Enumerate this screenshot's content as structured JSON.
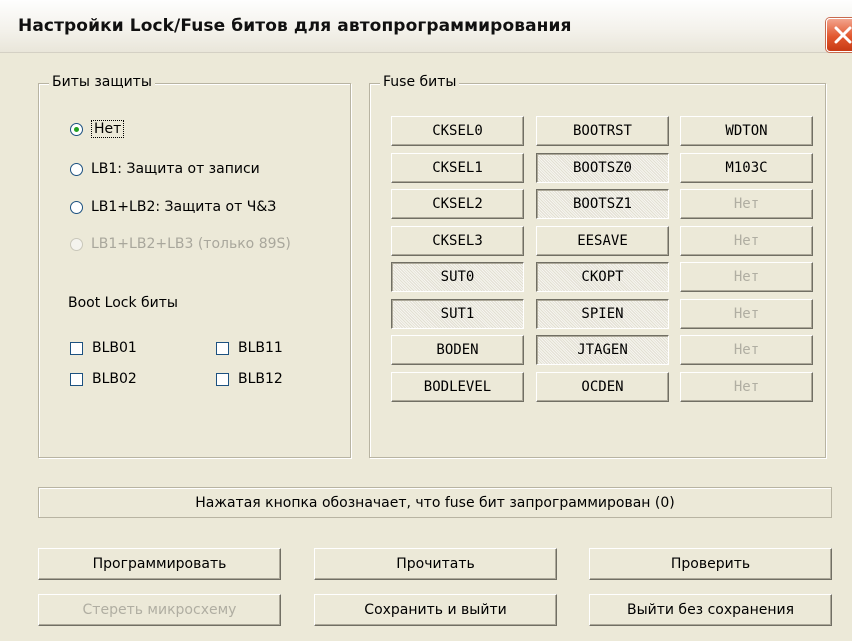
{
  "window": {
    "title": "Настройки Lock/Fuse битов для автопрограммирования",
    "close_icon": "close-icon"
  },
  "protection": {
    "legend": "Биты защиты",
    "options": [
      {
        "label": "Нет",
        "selected": true,
        "disabled": false
      },
      {
        "label": "LB1: Защита от записи",
        "selected": false,
        "disabled": false
      },
      {
        "label": "LB1+LB2: Защита от Ч&З",
        "selected": false,
        "disabled": false
      },
      {
        "label": "LB1+LB2+LB3 (только 89S)",
        "selected": false,
        "disabled": true
      }
    ],
    "boot_lock_label": "Boot Lock биты",
    "boot_lock": [
      {
        "label": "BLB01",
        "checked": false
      },
      {
        "label": "BLB11",
        "checked": false
      },
      {
        "label": "BLB02",
        "checked": false
      },
      {
        "label": "BLB12",
        "checked": false
      }
    ]
  },
  "fuse": {
    "legend": "Fuse биты",
    "col1": [
      {
        "label": "CKSEL0",
        "pressed": false,
        "disabled": false
      },
      {
        "label": "CKSEL1",
        "pressed": false,
        "disabled": false
      },
      {
        "label": "CKSEL2",
        "pressed": false,
        "disabled": false
      },
      {
        "label": "CKSEL3",
        "pressed": false,
        "disabled": false
      },
      {
        "label": "SUT0",
        "pressed": true,
        "disabled": false
      },
      {
        "label": "SUT1",
        "pressed": true,
        "disabled": false
      },
      {
        "label": "BODEN",
        "pressed": false,
        "disabled": false
      },
      {
        "label": "BODLEVEL",
        "pressed": false,
        "disabled": false
      }
    ],
    "col2": [
      {
        "label": "BOOTRST",
        "pressed": false,
        "disabled": false
      },
      {
        "label": "BOOTSZ0",
        "pressed": true,
        "disabled": false
      },
      {
        "label": "BOOTSZ1",
        "pressed": true,
        "disabled": false
      },
      {
        "label": "EESAVE",
        "pressed": false,
        "disabled": false
      },
      {
        "label": "CKOPT",
        "pressed": true,
        "disabled": false
      },
      {
        "label": "SPIEN",
        "pressed": true,
        "disabled": false
      },
      {
        "label": "JTAGEN",
        "pressed": true,
        "disabled": false
      },
      {
        "label": "OCDEN",
        "pressed": false,
        "disabled": false
      }
    ],
    "col3": [
      {
        "label": "WDTON",
        "pressed": false,
        "disabled": false
      },
      {
        "label": "M103C",
        "pressed": false,
        "disabled": false
      },
      {
        "label": "Нет",
        "pressed": false,
        "disabled": true
      },
      {
        "label": "Нет",
        "pressed": false,
        "disabled": true
      },
      {
        "label": "Нет",
        "pressed": false,
        "disabled": true
      },
      {
        "label": "Нет",
        "pressed": false,
        "disabled": true
      },
      {
        "label": "Нет",
        "pressed": false,
        "disabled": true
      },
      {
        "label": "Нет",
        "pressed": false,
        "disabled": true
      }
    ]
  },
  "status_text": "Нажатая кнопка обозначает, что fuse бит запрограммирован (0)",
  "actions": {
    "program": "Программировать",
    "read": "Прочитать",
    "verify": "Проверить",
    "erase": "Стереть микросхему",
    "save_exit": "Сохранить и выйти",
    "exit_no_save": "Выйти без сохранения"
  }
}
